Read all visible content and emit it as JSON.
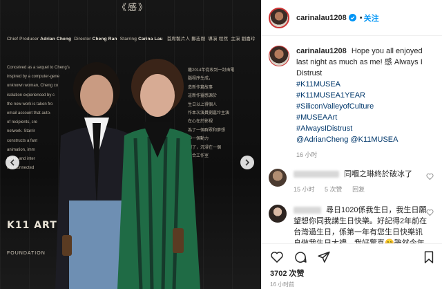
{
  "photo": {
    "top_text": "《感》",
    "credits": {
      "chief_producer_label": "Chief Producer",
      "chief_producer_name": "Adrian Cheng",
      "director_label": "Director",
      "director_name": "Cheng Ran",
      "starring_label": "Starring",
      "starring_name": "Carina Lau",
      "cn_producer": "首席製片人 鄭志剛",
      "cn_director": "導演 程然",
      "cn_starring": "主演 劉嘉玲"
    },
    "english_lines": [
      "Conceived as a sequel to Cheng's",
      "inspired by a computer-gene",
      "unknown woman, Cheng co",
      "isolation experienced by c",
      "the new work is taken fro",
      "email account that auto-",
      "of recipients, cre",
      "network. Starrir",
      "constructs a fant",
      "animation, imm",
      "tactile and inter",
      "interconnected"
    ],
    "chinese_lines": [
      "繼2014年從收到一封由電",
      "腦程序生成，",
      "造新作篇故事",
      "這新作靈感源於",
      "生日以上得個人",
      "作本次演員劉嘉玲主演",
      "在心在於影視",
      "為了一個群眾和夢想",
      "中一個動力",
      "到了，沉浸在一個",
      "結合工作室"
    ],
    "k11_logo": "K11 ART",
    "k11_sub": "FOUNDATION",
    "prev_icon": "chevron-left-icon",
    "next_icon": "chevron-right-icon"
  },
  "post": {
    "username": "carinalau1208",
    "follow_label": "关注",
    "dot": "•",
    "caption_text": "Hope you all enjoyed last night as much as me! 感 Always I Distrust",
    "hashtags": [
      "#K11MUSEA",
      "#K11MUSEA1YEAR",
      "#SiliconValleyofCulture",
      "#MUSEAArt",
      "#AlwaysIDistrust"
    ],
    "mentions": "@AdrianCheng @K11MUSEA",
    "caption_time": "16 小时"
  },
  "comments": [
    {
      "text_visible": "同嗰之琳終於破冰了",
      "time": "15 小时",
      "likes": "5 次赞",
      "reply_label": "回复",
      "avatar_color": "#b08d72"
    },
    {
      "text_visible": "尋日1020係我生日，我生日願望想你同我講生日快樂。好記得2年前在台灣過生日，係第一年有您生日快樂訊息做我生日大禮，我好驚喜😊雖然今年無得",
      "time": "",
      "likes": "",
      "reply_label": "",
      "avatar_color": "#8a6c5a"
    }
  ],
  "actions": {
    "like_icon": "heart-icon",
    "comment_icon": "comment-icon",
    "share_icon": "share-icon",
    "save_icon": "bookmark-icon",
    "likes_count": "3702 次赞",
    "posted_time": "16 小时前"
  },
  "colors": {
    "accent": "#0095f6",
    "link": "#00376b",
    "muted": "#8e8e8e"
  }
}
